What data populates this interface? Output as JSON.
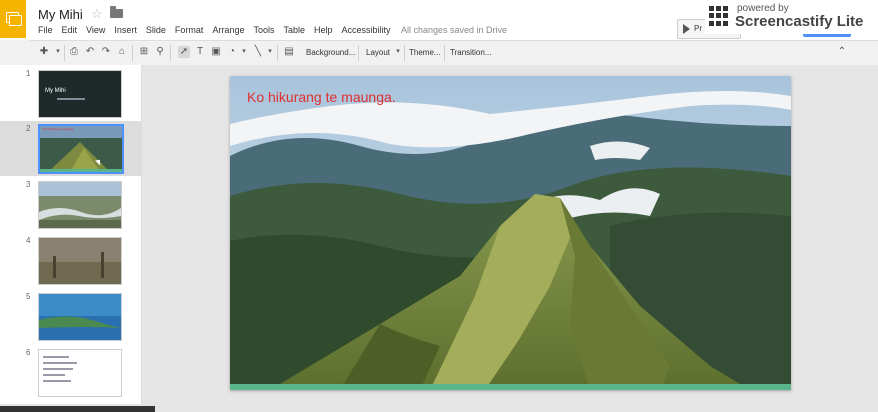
{
  "app": {
    "title": "My Mihi",
    "save_status": "All changes saved in Drive"
  },
  "menu": [
    "File",
    "Edit",
    "View",
    "Insert",
    "Slide",
    "Format",
    "Arrange",
    "Tools",
    "Table",
    "Help",
    "Accessibility"
  ],
  "toolbar": {
    "background": "Background...",
    "layout": "Layout",
    "theme": "Theme...",
    "transition": "Transition..."
  },
  "present": {
    "label": "Pr"
  },
  "watermark": {
    "powered": "powered by",
    "brand": "Screencastify Lite"
  },
  "slides": [
    {
      "num": "1",
      "title": "My Mihi"
    },
    {
      "num": "2",
      "title": "Ko hikurang te maunga."
    },
    {
      "num": "3",
      "title": ""
    },
    {
      "num": "4",
      "title": ""
    },
    {
      "num": "5",
      "title": ""
    },
    {
      "num": "6",
      "title": ""
    }
  ],
  "current_slide": {
    "caption": "Ko  hikurang te maunga."
  },
  "colors": {
    "accent": "#4d90fe",
    "slides_yellow": "#f4b400",
    "caption_red": "#e03030",
    "slide_bar_green": "#5ab58a"
  }
}
